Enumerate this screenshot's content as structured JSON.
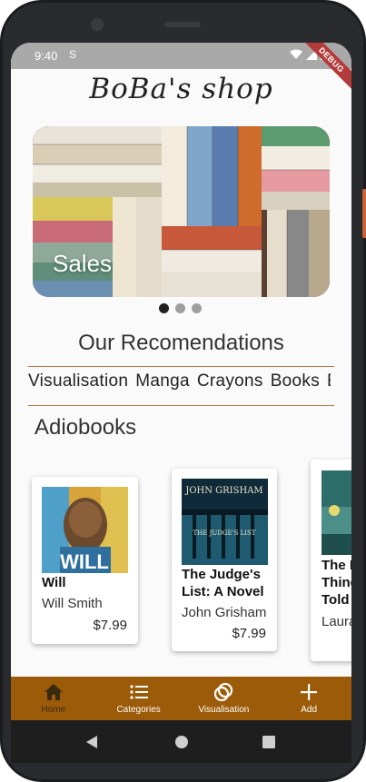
{
  "status_bar": {
    "time": "9:40",
    "left_icon": "S",
    "debug_label": "DEBUG"
  },
  "app": {
    "title": "BoBa's shop"
  },
  "banner": {
    "label": "Sales",
    "page_count": 3,
    "active_page": 1
  },
  "recommendations": {
    "title": "Our Recomendations",
    "categories": [
      "Visualisation",
      "Manga",
      "Crayons",
      "Books",
      "E"
    ]
  },
  "audiobooks": {
    "title": "Adiobooks",
    "books": [
      {
        "title": "Will",
        "author": "Will Smith",
        "price": "$7.99",
        "cover_text": "WILL"
      },
      {
        "title": "The Judge's List: A Novel",
        "author": "John Grisham",
        "price": "$7.99",
        "cover_author": "JOHN GRISHAM",
        "cover_title": "THE JUDGE'S LIST"
      },
      {
        "title": "The L... Thing... Told",
        "title_lines": [
          "The L",
          "Thing",
          "Told"
        ],
        "author": "Laura"
      }
    ]
  },
  "bottom_nav": {
    "items": [
      {
        "label": "Home",
        "icon": "home-icon",
        "active": true
      },
      {
        "label": "Categories",
        "icon": "list-icon",
        "active": false
      },
      {
        "label": "Visualisation",
        "icon": "rings-icon",
        "active": false
      },
      {
        "label": "Add",
        "icon": "plus-icon",
        "active": false
      }
    ]
  },
  "colors": {
    "accent": "#9c5b08",
    "divider": "#b07a4a",
    "status_bar": "#a9a9a9"
  }
}
